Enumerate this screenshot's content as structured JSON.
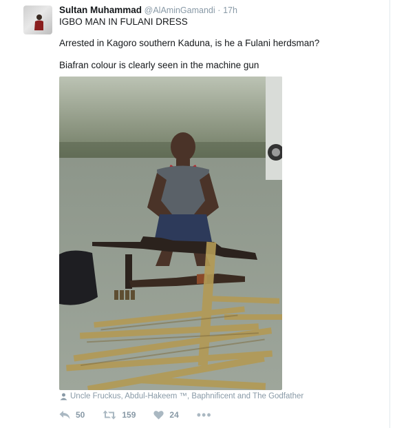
{
  "tweet": {
    "author_name": "Sultan Muhammad",
    "author_handle": "@AlAminGamandi",
    "separator": "·",
    "timestamp": "17h",
    "lines": [
      "IGBO MAN IN FULANI DRESS",
      "Arrested in Kagoro southern Kaduna, is he a Fulani herdsman?",
      "Biafran colour is clearly seen in the machine gun"
    ],
    "tagged_people": "Uncle Fruckus, Abdul-Hakeem ™, Baphnificent and The Godfather",
    "actions": {
      "reply_count": "50",
      "retweet_count": "159",
      "like_count": "24",
      "more_label": "•••"
    }
  },
  "colors": {
    "text": "#14171a",
    "secondary": "#8899a6",
    "action_icon": "#aab8c2"
  },
  "icons": [
    "reply-icon",
    "retweet-icon",
    "heart-icon",
    "more-icon",
    "person-icon"
  ]
}
